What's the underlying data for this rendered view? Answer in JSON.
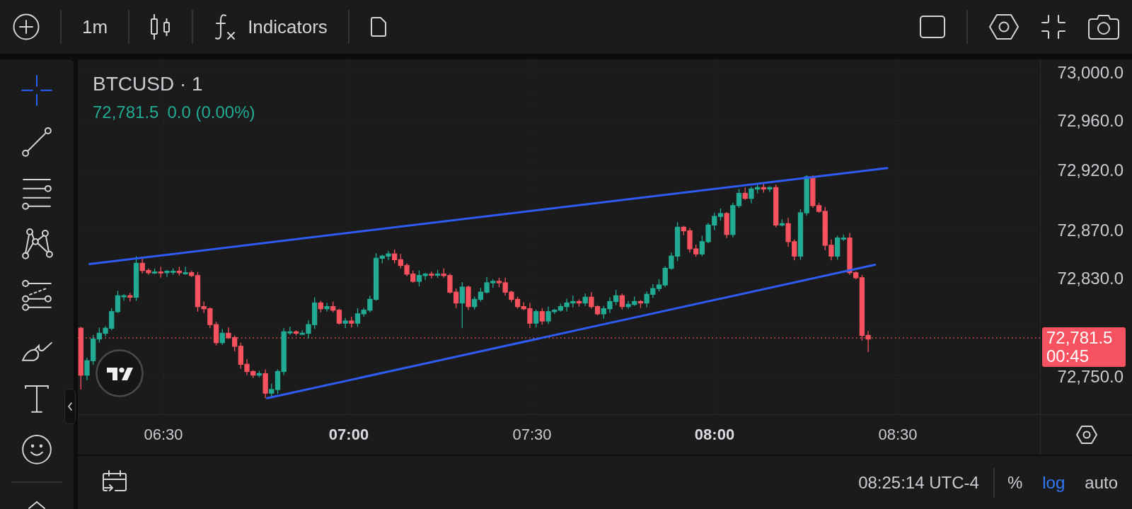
{
  "toolbar": {
    "interval": "1m",
    "indicators": "Indicators"
  },
  "drawing_tools": [
    {
      "kind": "crosshair",
      "selected": true
    },
    {
      "kind": "line",
      "selected": false
    },
    {
      "kind": "parallel",
      "selected": false
    },
    {
      "kind": "pattern",
      "selected": false
    },
    {
      "kind": "fib",
      "selected": false
    },
    {
      "kind": "brush",
      "selected": false
    },
    {
      "kind": "text",
      "selected": false
    },
    {
      "kind": "emoji",
      "selected": false
    }
  ],
  "legend": {
    "title": "BTCUSD · 1",
    "last_price": "72,781.5",
    "change": "0.0 (0.00%)"
  },
  "price_axis": {
    "labels": [
      "73,000.0",
      "72,960.0",
      "72,920.0",
      "72,870.0",
      "72,830.0",
      "72,750.0"
    ],
    "price_tag": {
      "price": "72,781.5",
      "countdown": "00:45"
    }
  },
  "time_axis": {
    "labels": [
      {
        "text": "06:30",
        "major": false
      },
      {
        "text": "07:00",
        "major": true
      },
      {
        "text": "07:30",
        "major": false
      },
      {
        "text": "08:00",
        "major": true
      },
      {
        "text": "08:30",
        "major": false
      }
    ]
  },
  "status_bar": {
    "time": "08:25:14 UTC-4",
    "scale_options": [
      {
        "label": "%",
        "selected": false
      },
      {
        "label": "log",
        "selected": true
      },
      {
        "label": "auto",
        "selected": false
      }
    ]
  }
}
